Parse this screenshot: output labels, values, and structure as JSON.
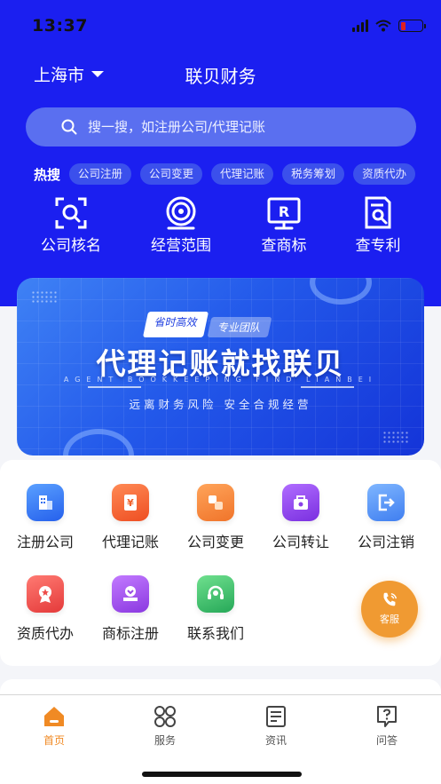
{
  "status_bar": {
    "time": "13:37"
  },
  "header": {
    "city": "上海市",
    "title": "联贝财务"
  },
  "search": {
    "placeholder": "搜一搜，如注册公司/代理记账"
  },
  "hot": {
    "label": "热搜",
    "tags": [
      "公司注册",
      "公司变更",
      "代理记账",
      "税务筹划",
      "资质代办"
    ]
  },
  "quick_tools": [
    "公司核名",
    "经营范围",
    "查商标",
    "查专利"
  ],
  "banner": {
    "tag1": "省时高效",
    "tag2": "专业团队",
    "title": "代理记账就找联贝",
    "subtitle_en": "AGENT BOOKKEEPING FIND LIANBEI",
    "subtitle": "远离财务风险  安全合规经营"
  },
  "services": [
    {
      "label": "注册公司",
      "icon": "building-icon",
      "color": "#2f6df0"
    },
    {
      "label": "代理记账",
      "icon": "ledger-icon",
      "color": "#f0602a"
    },
    {
      "label": "公司变更",
      "icon": "change-icon",
      "color": "#f07d2a"
    },
    {
      "label": "公司转让",
      "icon": "transfer-icon",
      "color": "#8a3ee8"
    },
    {
      "label": "公司注销",
      "icon": "logout-icon",
      "color": "#3f86f0"
    },
    {
      "label": "资质代办",
      "icon": "badge-icon",
      "color": "#ee4b48"
    },
    {
      "label": "商标注册",
      "icon": "trademark-icon",
      "color": "#9a48e4"
    },
    {
      "label": "联系我们",
      "icon": "headset-icon",
      "color": "#32b868"
    }
  ],
  "fab": {
    "label": "客服",
    "icon": "phone-icon"
  },
  "tabbar": [
    {
      "label": "首页",
      "icon": "home-icon",
      "active": true
    },
    {
      "label": "服务",
      "icon": "grid-icon",
      "active": false
    },
    {
      "label": "资讯",
      "icon": "news-icon",
      "active": false
    },
    {
      "label": "问答",
      "icon": "qa-icon",
      "active": false
    }
  ],
  "colors": {
    "brand": "#1b1ff0",
    "accent": "#f08a24",
    "search_bg": "#5a6ff0"
  }
}
